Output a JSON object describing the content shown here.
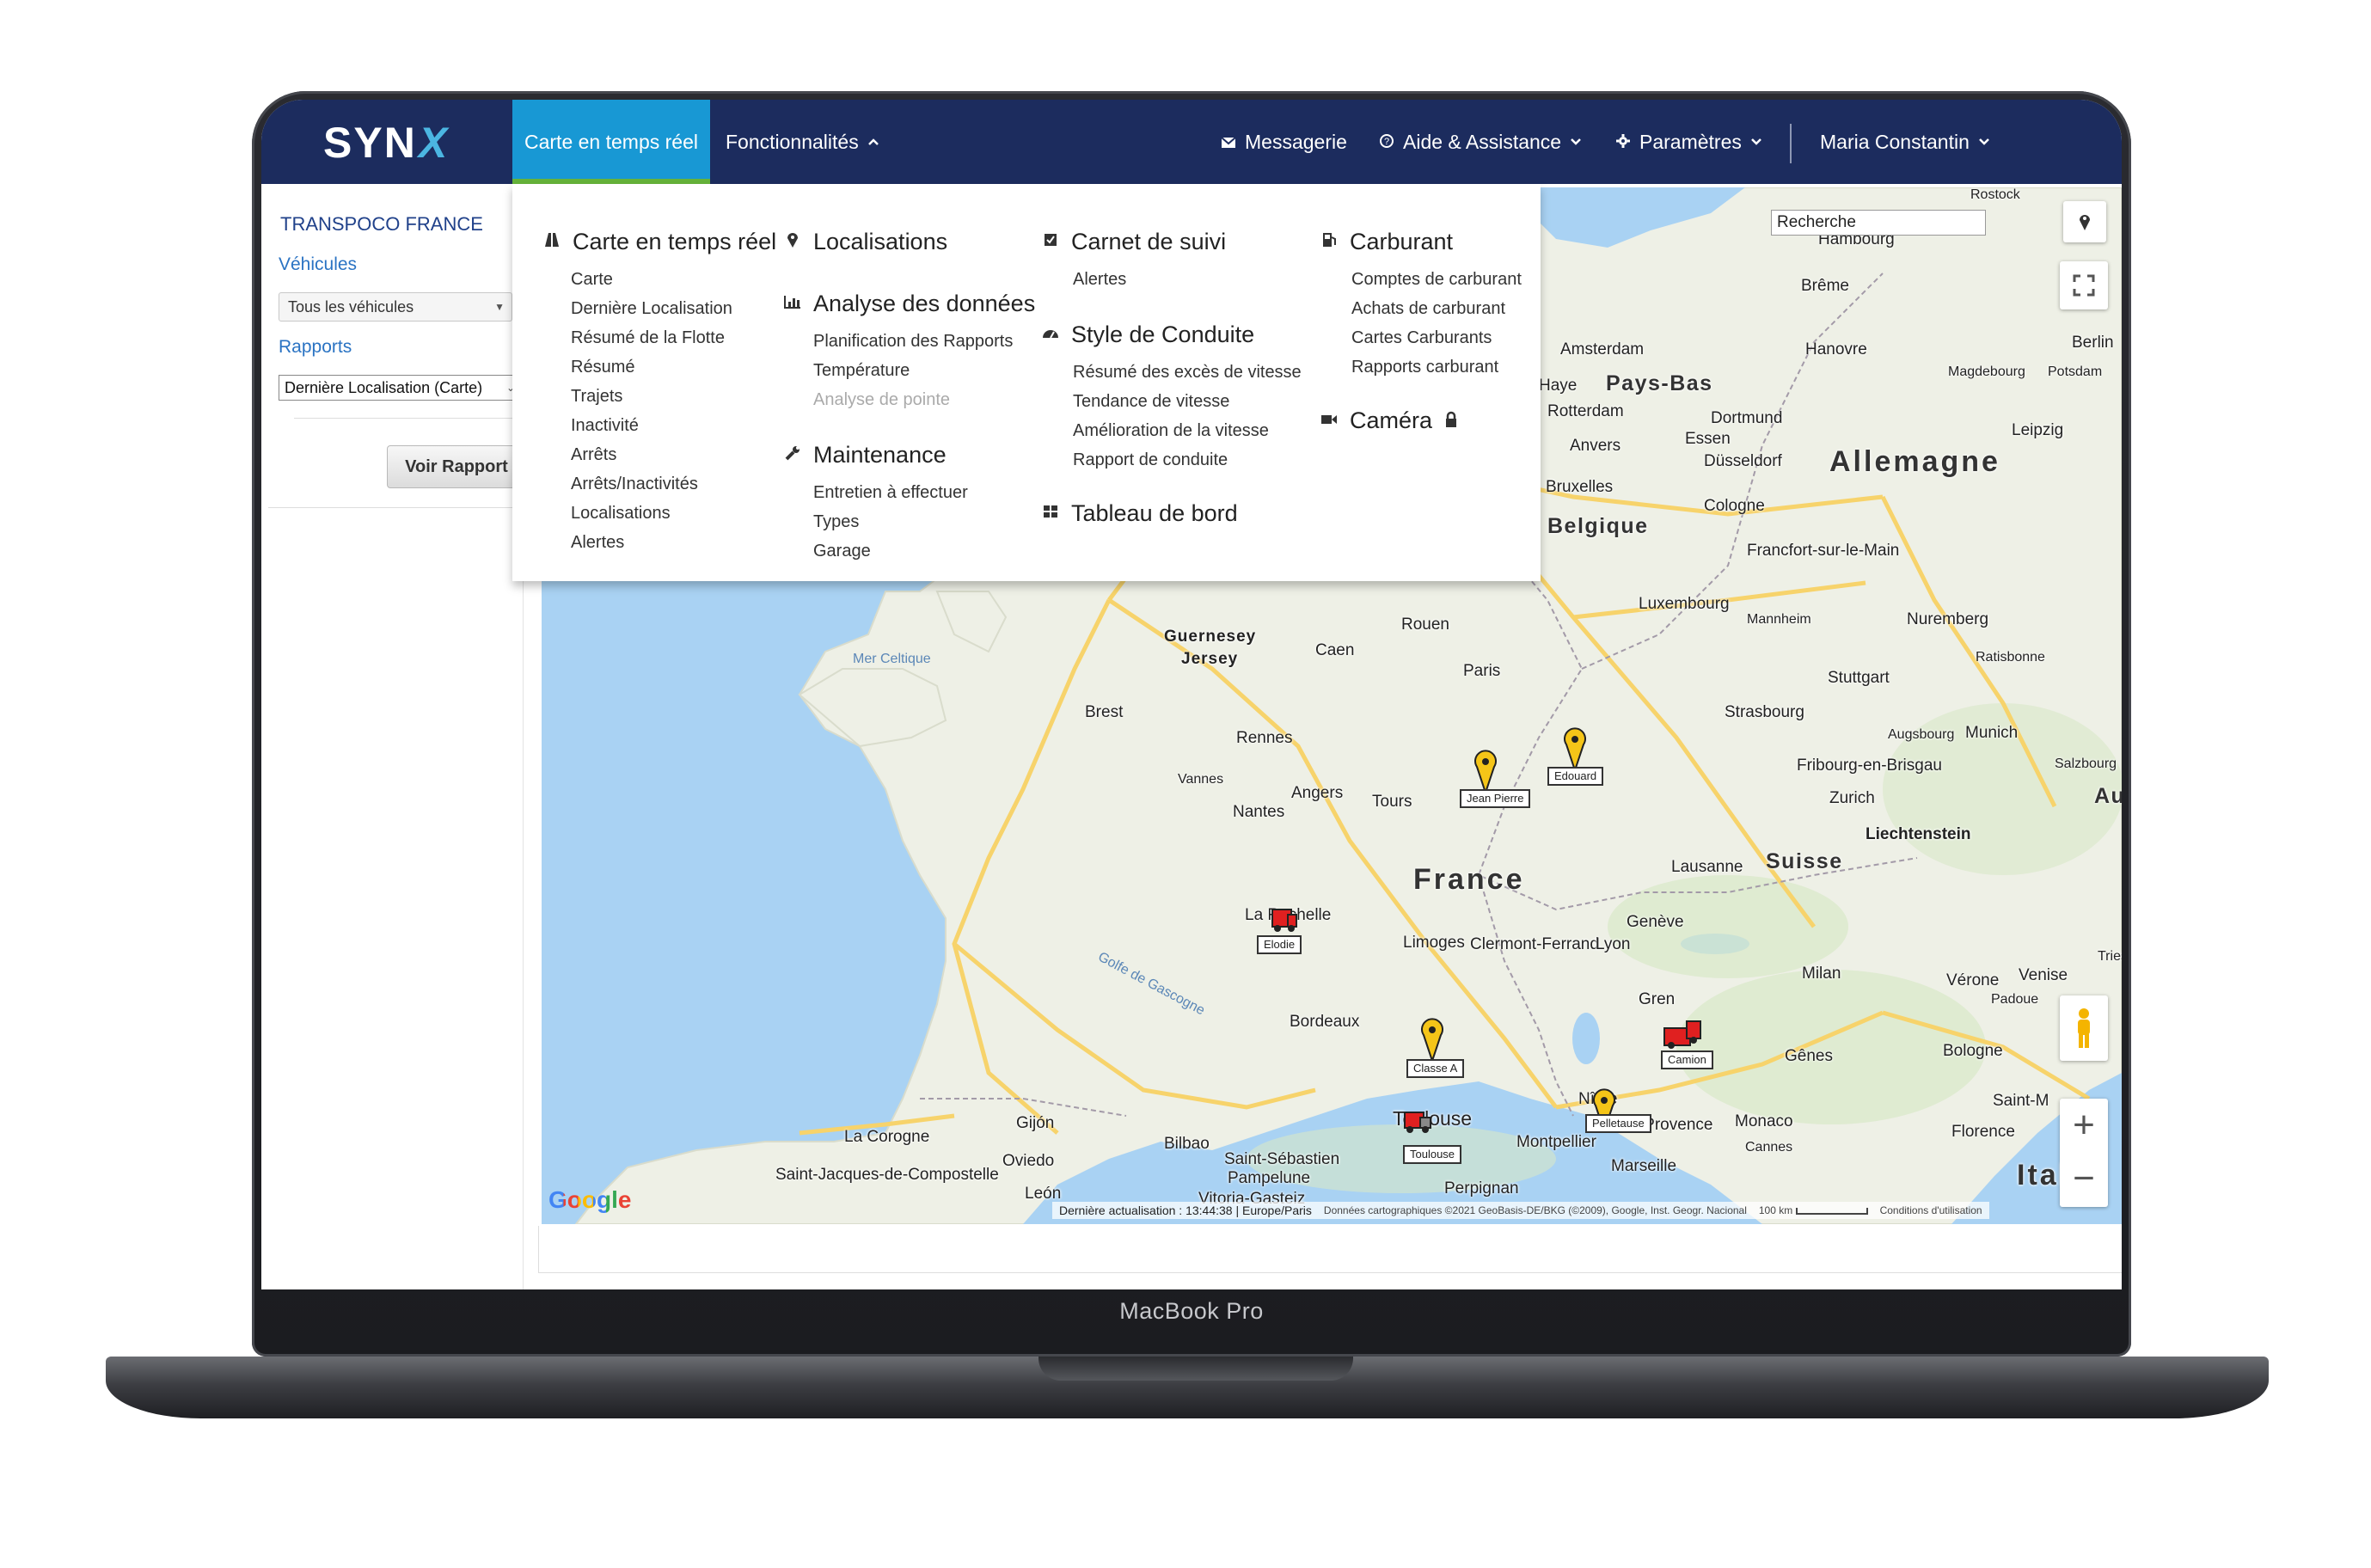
{
  "device": {
    "model_label": "MacBook Pro"
  },
  "colors": {
    "navbar": "#1c2c5e",
    "active_tab": "#1898d4",
    "active_tab_underline": "#66b33a",
    "link": "#2a73c3",
    "map_water": "#a9d2f3",
    "map_land": "#eef0e6"
  },
  "app": {
    "logo_text": "SYN",
    "logo_accent": "X"
  },
  "navbar": {
    "live_map": "Carte en temps réel",
    "features": "Fonctionnalités",
    "messages": "Messagerie",
    "help": "Aide & Assistance",
    "settings": "Paramètres",
    "user": "Maria Constantin"
  },
  "sidebar": {
    "company": "TRANSPOCO FRANCE",
    "vehicles_label": "Véhicules",
    "vehicles_select": "Tous les véhicules",
    "reports_label": "Rapports",
    "reports_select": "Dernière Localisation (Carte)",
    "view_report": "Voir Rapport"
  },
  "menu": {
    "live_map": {
      "title": "Carte en temps réel",
      "icon": "road-icon",
      "items": [
        "Carte",
        "Dernière Localisation",
        "Résumé de la Flotte",
        "Résumé",
        "Trajets",
        "Inactivité",
        "Arrêts",
        "Arrêts/Inactivités",
        "Localisations",
        "Alertes"
      ]
    },
    "locations": {
      "title": "Localisations",
      "icon": "map-pin-icon"
    },
    "data_analysis": {
      "title": "Analyse des données",
      "icon": "chart-icon",
      "items": [
        "Planification des Rapports",
        "Température"
      ],
      "disabled_item": "Analyse de pointe"
    },
    "maintenance": {
      "title": "Maintenance",
      "icon": "wrench-icon",
      "items": [
        "Entretien à effectuer",
        "Types",
        "Garage"
      ]
    },
    "logbook": {
      "title": "Carnet de suivi",
      "icon": "checkbox-icon",
      "items": [
        "Alertes"
      ]
    },
    "driving_style": {
      "title": "Style de Conduite",
      "icon": "dashboard-gauge-icon",
      "items": [
        "Résumé des excès de vitesse",
        "Tendance de vitesse",
        "Amélioration de la vitesse",
        "Rapport de conduite"
      ]
    },
    "dashboard": {
      "title": "Tableau de bord",
      "icon": "grid-icon"
    },
    "fuel": {
      "title": "Carburant",
      "icon": "fuel-pump-icon",
      "items": [
        "Comptes de carburant",
        "Achats de carburant",
        "Cartes Carburants",
        "Rapports carburant"
      ]
    },
    "camera": {
      "title": "Caméra",
      "icon": "video-camera-icon",
      "lock_icon": "lock-icon"
    }
  },
  "map": {
    "search_value": "Recherche",
    "cities": [
      {
        "id": "rostock",
        "name": "Rostock",
        "size": "small"
      },
      {
        "id": "hamburg",
        "name": "Hambourg",
        "size": "normal"
      },
      {
        "id": "bremen",
        "name": "Brême",
        "size": "normal"
      },
      {
        "id": "berlin",
        "name": "Berlin",
        "size": "normal"
      },
      {
        "id": "amsterdam",
        "name": "Amsterdam",
        "size": "normal"
      },
      {
        "id": "hanover",
        "name": "Hanovre",
        "size": "normal"
      },
      {
        "id": "magdeburg",
        "name": "Magdebourg",
        "size": "small"
      },
      {
        "id": "potsdam",
        "name": "Potsdam",
        "size": "small"
      },
      {
        "id": "hague",
        "name": "Haye",
        "size": "normal"
      },
      {
        "id": "netherlands",
        "name": "Pays-Bas",
        "size": "mid"
      },
      {
        "id": "rotterdam",
        "name": "Rotterdam",
        "size": "normal"
      },
      {
        "id": "dortmund",
        "name": "Dortmund",
        "size": "normal"
      },
      {
        "id": "antwerp",
        "name": "Anvers",
        "size": "normal"
      },
      {
        "id": "essen",
        "name": "Essen",
        "size": "normal"
      },
      {
        "id": "leipzig",
        "name": "Leipzig",
        "size": "normal"
      },
      {
        "id": "dusseldorf",
        "name": "Düsseldorf",
        "size": "normal"
      },
      {
        "id": "germany",
        "name": "Allemagne",
        "size": "big"
      },
      {
        "id": "brussels",
        "name": "Bruxelles",
        "size": "normal"
      },
      {
        "id": "cologne",
        "name": "Cologne",
        "size": "normal"
      },
      {
        "id": "belgium",
        "name": "Belgique",
        "size": "mid"
      },
      {
        "id": "frankfurt",
        "name": "Francfort-sur-le-Main",
        "size": "normal"
      },
      {
        "id": "luxembourg",
        "name": "Luxembourg",
        "size": "normal"
      },
      {
        "id": "rouen",
        "name": "Rouen",
        "size": "normal"
      },
      {
        "id": "mannheim",
        "name": "Mannheim",
        "size": "small"
      },
      {
        "id": "nuremberg",
        "name": "Nuremberg",
        "size": "normal"
      },
      {
        "id": "guernsey",
        "name": "Guernesey",
        "size": "normal"
      },
      {
        "id": "jersey",
        "name": "Jersey",
        "size": "normal"
      },
      {
        "id": "caen",
        "name": "Caen",
        "size": "normal"
      },
      {
        "id": "paris",
        "name": "Paris",
        "size": "normal"
      },
      {
        "id": "ratisbonne",
        "name": "Ratisbonne",
        "size": "small"
      },
      {
        "id": "stuttgart",
        "name": "Stuttgart",
        "size": "normal"
      },
      {
        "id": "strasbourg",
        "name": "Strasbourg",
        "size": "normal"
      },
      {
        "id": "augsburg",
        "name": "Augsbourg",
        "size": "small"
      },
      {
        "id": "munich",
        "name": "Munich",
        "size": "normal"
      },
      {
        "id": "brest",
        "name": "Brest",
        "size": "normal"
      },
      {
        "id": "rennes",
        "name": "Rennes",
        "size": "normal"
      },
      {
        "id": "freiburg",
        "name": "Fribourg-en-Brisgau",
        "size": "normal"
      },
      {
        "id": "salzburg",
        "name": "Salzbourg",
        "size": "small"
      },
      {
        "id": "vannes",
        "name": "Vannes",
        "size": "small"
      },
      {
        "id": "zurich",
        "name": "Zurich",
        "size": "normal"
      },
      {
        "id": "austria",
        "name": "Aut",
        "size": "mid"
      },
      {
        "id": "angers",
        "name": "Angers",
        "size": "normal"
      },
      {
        "id": "nantes",
        "name": "Nantes",
        "size": "normal"
      },
      {
        "id": "tours",
        "name": "Tours",
        "size": "normal"
      },
      {
        "id": "liechtenstein",
        "name": "Liechtenstein",
        "size": "normal"
      },
      {
        "id": "france",
        "name": "France",
        "size": "big"
      },
      {
        "id": "lausanne",
        "name": "Lausanne",
        "size": "normal"
      },
      {
        "id": "switzerland",
        "name": "Suisse",
        "size": "mid"
      },
      {
        "id": "larochelle",
        "name": "La Rochelle",
        "size": "normal"
      },
      {
        "id": "geneva",
        "name": "Genève",
        "size": "normal"
      },
      {
        "id": "limoges",
        "name": "Limoges",
        "size": "normal"
      },
      {
        "id": "clermont",
        "name": "Clermont-Ferrand",
        "size": "normal"
      },
      {
        "id": "lyon",
        "name": "Lyon",
        "size": "normal"
      },
      {
        "id": "milan",
        "name": "Milan",
        "size": "normal"
      },
      {
        "id": "verona",
        "name": "Vérone",
        "size": "normal"
      },
      {
        "id": "venice",
        "name": "Venise",
        "size": "normal"
      },
      {
        "id": "padua",
        "name": "Padoue",
        "size": "small"
      },
      {
        "id": "trieste",
        "name": "Tries",
        "size": "small"
      },
      {
        "id": "grenoble",
        "name": "Gren",
        "size": "normal"
      },
      {
        "id": "bordeaux",
        "name": "Bordeaux",
        "size": "normal"
      },
      {
        "id": "genoa",
        "name": "Gênes",
        "size": "normal"
      },
      {
        "id": "bologna",
        "name": "Bologne",
        "size": "normal"
      },
      {
        "id": "nimes",
        "name": "Nîme",
        "size": "normal"
      },
      {
        "id": "aix",
        "name": "Aix-en-Provence",
        "size": "normal"
      },
      {
        "id": "monaco",
        "name": "Monaco",
        "size": "normal"
      },
      {
        "id": "saintm",
        "name": "Saint-M",
        "size": "normal"
      },
      {
        "id": "toulouse",
        "name": "Toulouse",
        "size": "mid"
      },
      {
        "id": "montpellier",
        "name": "Montpellier",
        "size": "normal"
      },
      {
        "id": "cannes",
        "name": "Cannes",
        "size": "small"
      },
      {
        "id": "florence",
        "name": "Florence",
        "size": "normal"
      },
      {
        "id": "lacoruna",
        "name": "La Corogne",
        "size": "normal"
      },
      {
        "id": "gijon",
        "name": "Gijón",
        "size": "normal"
      },
      {
        "id": "bilbao",
        "name": "Bilbao",
        "size": "normal"
      },
      {
        "id": "sansebastian",
        "name": "Saint-Sébastien",
        "size": "normal"
      },
      {
        "id": "marseille",
        "name": "Marseille",
        "size": "normal"
      },
      {
        "id": "santiago",
        "name": "Saint-Jacques-de-Compostelle",
        "size": "normal"
      },
      {
        "id": "oviedo",
        "name": "Oviedo",
        "size": "normal"
      },
      {
        "id": "pamplona",
        "name": "Pampelune",
        "size": "normal"
      },
      {
        "id": "perpignan",
        "name": "Perpignan",
        "size": "normal"
      },
      {
        "id": "italy",
        "name": "Itali",
        "size": "big"
      },
      {
        "id": "leon",
        "name": "León",
        "size": "normal"
      },
      {
        "id": "vitoria",
        "name": "Vitoria-Gasteiz",
        "size": "normal"
      }
    ],
    "seas": [
      {
        "id": "celtic",
        "name": "Mer Celtique"
      },
      {
        "id": "biscay",
        "name": "Golfe de Gascogne"
      }
    ],
    "vehicles": [
      {
        "id": "jean-pierre",
        "label": "Jean Pierre",
        "type": "pin",
        "color": "#f5c518"
      },
      {
        "id": "edouard",
        "label": "Edouard",
        "type": "pin",
        "color": "#f5c518"
      },
      {
        "id": "elodie",
        "label": "Elodie",
        "type": "truck",
        "color": "#e02020"
      },
      {
        "id": "classe-a",
        "label": "Classe A",
        "type": "pin",
        "color": "#f5c518"
      },
      {
        "id": "camion",
        "label": "Camion",
        "type": "truck",
        "color": "#e02020"
      },
      {
        "id": "pelletause",
        "label": "Pelletause",
        "type": "pin",
        "color": "#f5c518"
      },
      {
        "id": "toulouse-v",
        "label": "Toulouse",
        "type": "truck",
        "color": "#e02020"
      }
    ],
    "google": "Google",
    "footer": {
      "last_update_label": "Dernière actualisation : 13:44:38 | Europe/Paris",
      "credits": "Données cartographiques ©2021 GeoBasis-DE/BKG (©2009), Google, Inst. Geogr. Nacional",
      "scale": "100 km",
      "terms": "Conditions d'utilisation"
    }
  }
}
